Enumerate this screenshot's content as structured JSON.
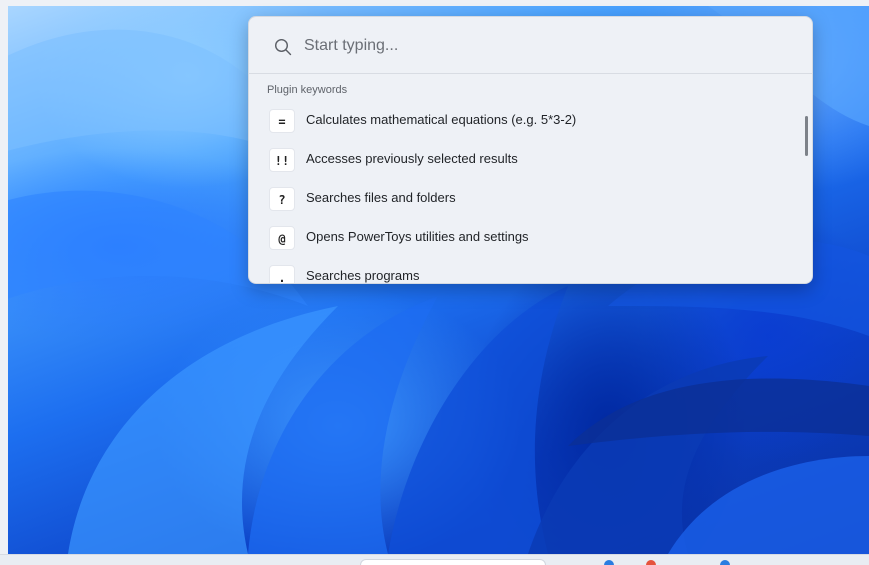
{
  "search": {
    "placeholder": "Start typing...",
    "value": ""
  },
  "results_section": {
    "header": "Plugin keywords",
    "items": [
      {
        "keyword": "=",
        "label": "Calculates mathematical equations (e.g. 5*3-2)"
      },
      {
        "keyword": "!!",
        "label": "Accesses previously selected results"
      },
      {
        "keyword": "?",
        "label": "Searches files and folders"
      },
      {
        "keyword": "@",
        "label": "Opens PowerToys utilities and settings"
      },
      {
        "keyword": ".",
        "label": "Searches programs"
      }
    ]
  },
  "icons": {
    "search": "search-icon"
  },
  "colors": {
    "panel_bg": "#eef1f6",
    "accent_wallpaper": "#1d6ff0",
    "text_primary": "#1f2226",
    "text_secondary": "#5f636a"
  }
}
